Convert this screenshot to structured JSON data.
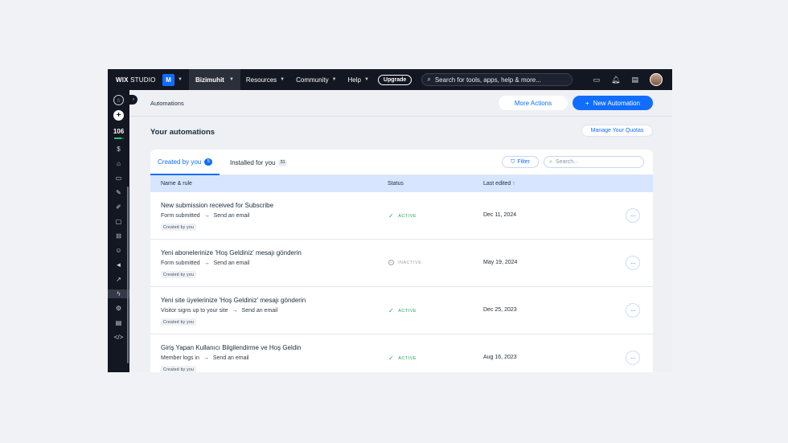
{
  "topbar": {
    "brand_bold": "WIX",
    "brand_rest": " STUDIO",
    "site_initial": "M",
    "site_name": "Bizimuhit",
    "nav": [
      "Resources",
      "Community",
      "Help"
    ],
    "upgrade": "Upgrade",
    "search_placeholder": "Search for tools, apps, help & more..."
  },
  "sidebar": {
    "score": "106"
  },
  "page": {
    "breadcrumb": "Automations",
    "more_actions": "More Actions",
    "new_automation": "New Automation",
    "section_title": "Your automations",
    "manage_quotas": "Manage Your Quotas"
  },
  "tabs": [
    {
      "label": "Created by you",
      "count": "5"
    },
    {
      "label": "Installed for you",
      "count": "31"
    }
  ],
  "toolbar": {
    "filter": "Filter",
    "search_placeholder": "Search..."
  },
  "columns": {
    "name": "Name & rule",
    "status": "Status",
    "last_edited": "Last edited",
    "sort_arrow": "↑"
  },
  "rows": [
    {
      "title": "New submission received for Subscribe",
      "trigger": "Form submitted",
      "action": "Send an email",
      "tag": "Created by you",
      "status": "ACTIVE",
      "date": "Dec 11, 2024"
    },
    {
      "title": "Yeni abonelerinize 'Hoş Geldiniz' mesajı gönderin",
      "trigger": "Form submitted",
      "action": "Send an email",
      "tag": "Created by you",
      "status": "INACTIVE",
      "date": "May 19, 2024"
    },
    {
      "title": "Yeni site üyelerinize 'Hoş Geldiniz' mesajı gönderin",
      "trigger": "Visitor signs up to your site",
      "action": "Send an email",
      "tag": "Created by you",
      "status": "ACTIVE",
      "date": "Dec 25, 2023"
    },
    {
      "title": "Giriş Yapan Kullanıcı Bilgilendirme ve Hoş Geldin",
      "trigger": "Member logs in",
      "action": "Send an email",
      "tag": "Created by you",
      "status": "ACTIVE",
      "date": "Aug 16, 2023"
    }
  ],
  "rule_arrow": "→",
  "more_glyph": "···",
  "colors": {
    "accent": "#116dff",
    "active": "#25a55f",
    "topbar": "#131722"
  }
}
